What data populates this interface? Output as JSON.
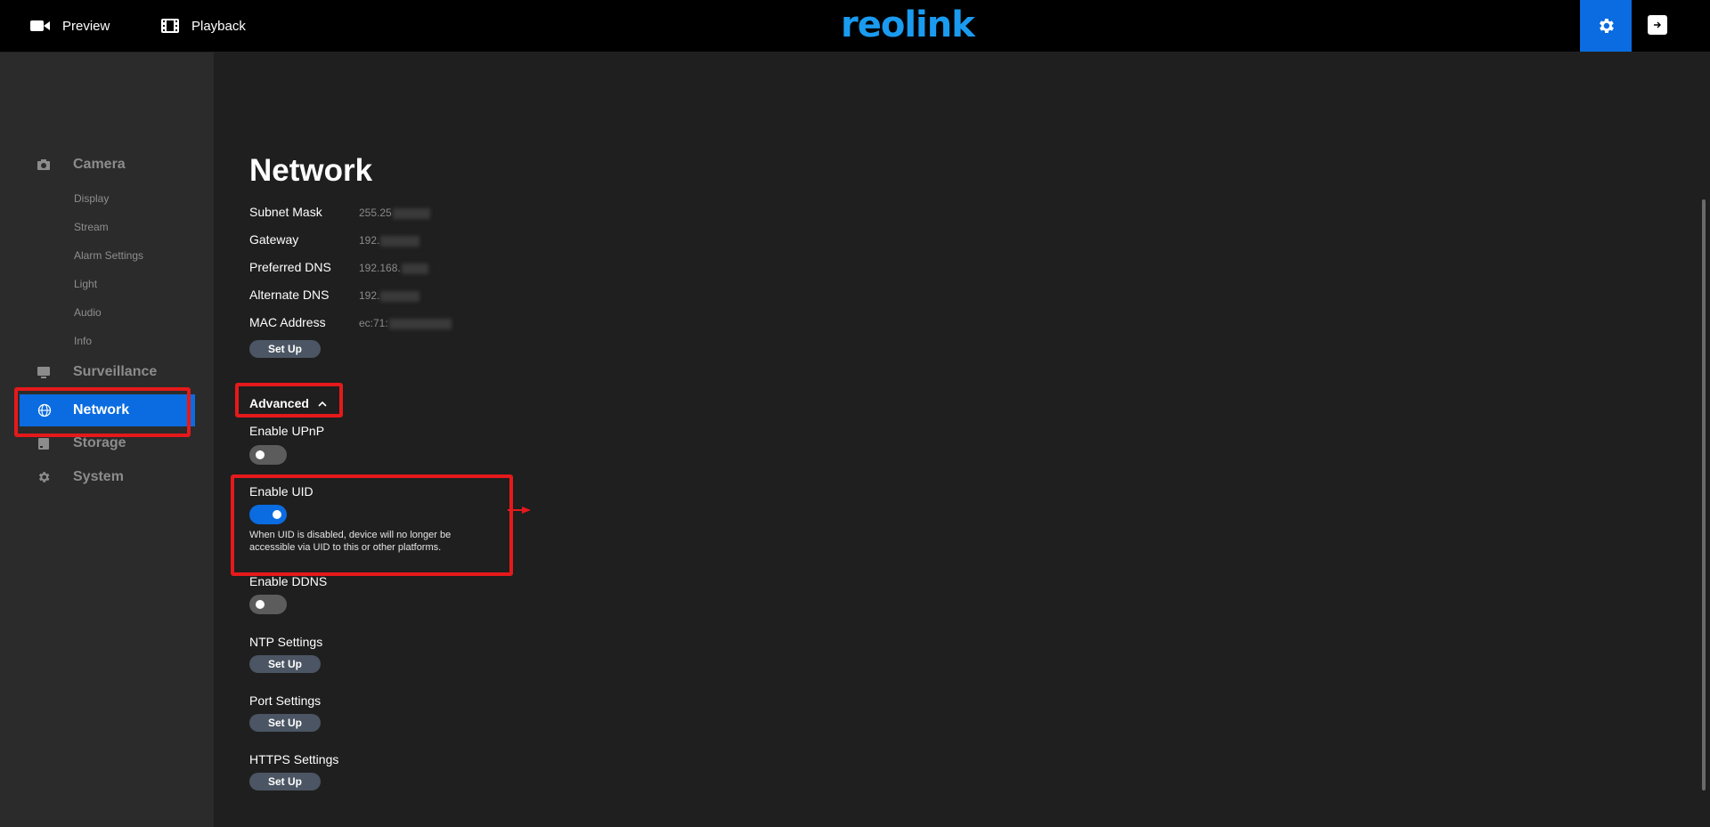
{
  "topbar": {
    "preview": "Preview",
    "playback": "Playback",
    "logo": "reolink",
    "settings_icon": "gear-icon",
    "logout_icon": "logout-icon"
  },
  "sidebar": {
    "camera": {
      "label": "Camera",
      "icon": "camera-icon",
      "sub": [
        "Display",
        "Stream",
        "Alarm Settings",
        "Light",
        "Audio",
        "Info"
      ]
    },
    "surveillance": {
      "label": "Surveillance",
      "icon": "monitor-icon"
    },
    "network": {
      "label": "Network",
      "icon": "globe-icon"
    },
    "storage": {
      "label": "Storage",
      "icon": "storage-icon"
    },
    "system": {
      "label": "System",
      "icon": "gear-icon"
    }
  },
  "main": {
    "title": "Network",
    "fields": [
      {
        "label": "Subnet Mask",
        "value": "255.25"
      },
      {
        "label": "Gateway",
        "value": "192."
      },
      {
        "label": "Preferred DNS",
        "value": "192.168."
      },
      {
        "label": "Alternate DNS",
        "value": "192."
      },
      {
        "label": "MAC Address",
        "value": "ec:71:"
      }
    ],
    "setup_label": "Set Up",
    "advanced": "Advanced",
    "upnp": {
      "label": "Enable UPnP",
      "enabled": false
    },
    "uid": {
      "label": "Enable UID",
      "enabled": true,
      "note": "When UID is disabled, device will no longer be accessible via UID to this or other platforms."
    },
    "ddns": {
      "label": "Enable DDNS",
      "enabled": false
    },
    "ntp": "NTP Settings",
    "port": "Port Settings",
    "https": "HTTPS Settings"
  },
  "colors": {
    "accent": "#0a6ce0",
    "highlight": "#e5191b",
    "logo": "#1a9bf0"
  }
}
